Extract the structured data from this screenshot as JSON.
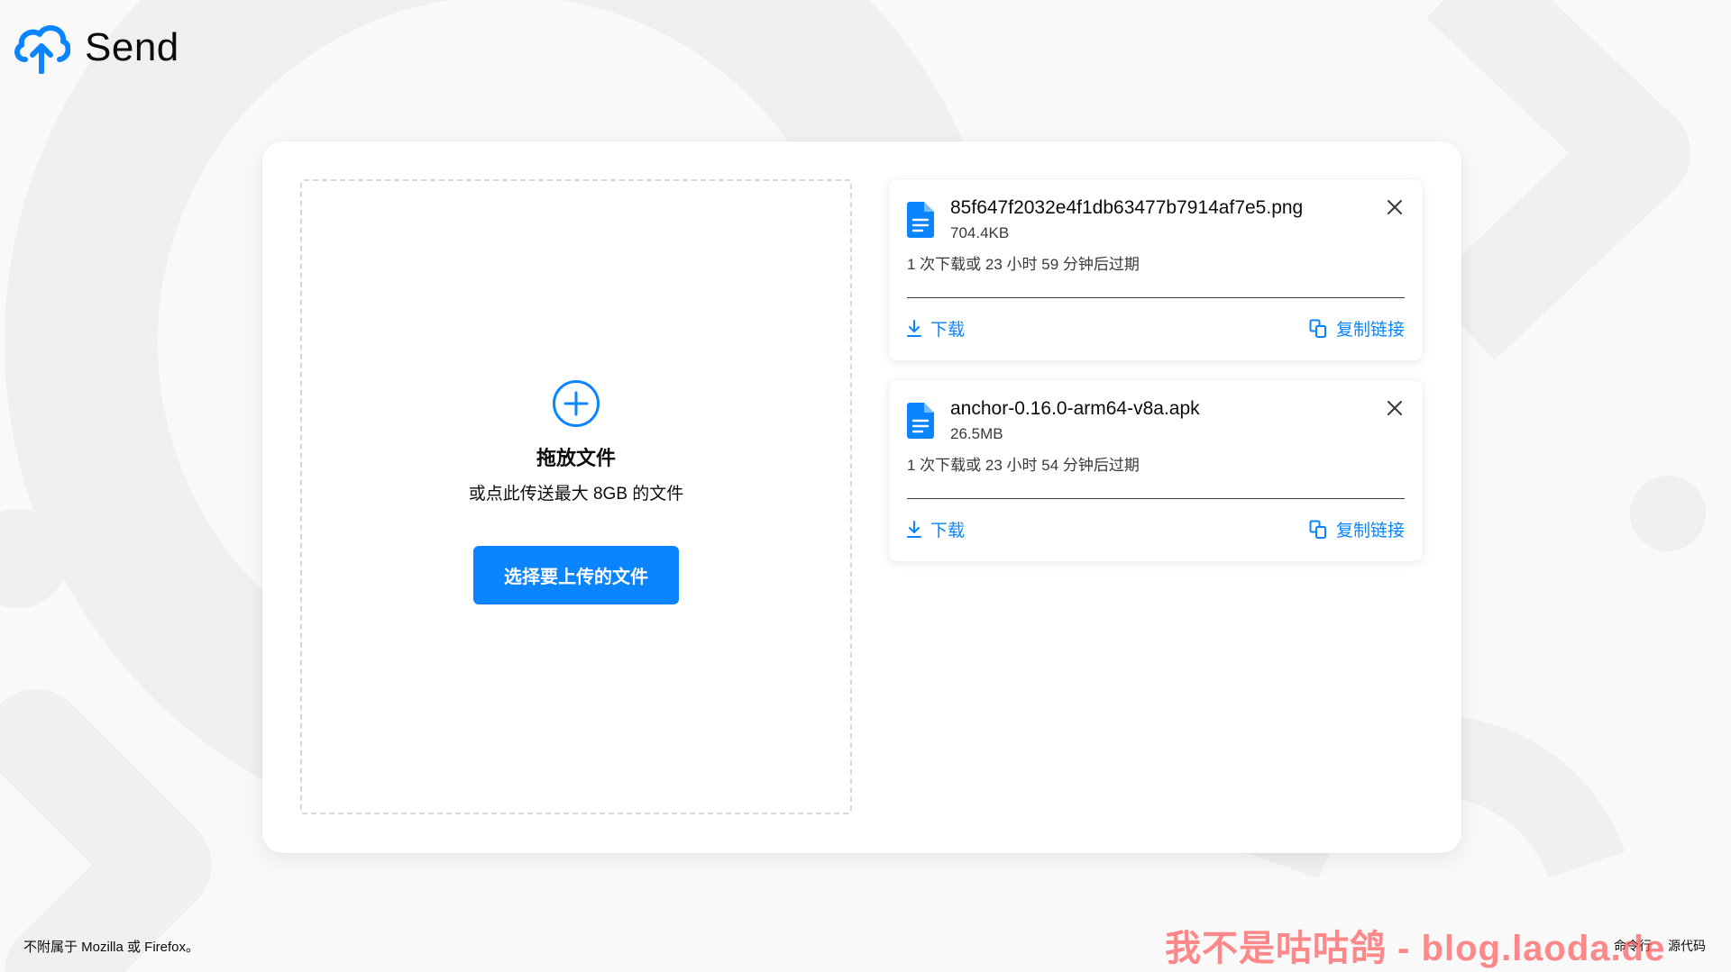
{
  "app": {
    "title": "Send",
    "logo_icon": "cloud-upload-icon"
  },
  "colors": {
    "accent": "#0a84ff",
    "background": "#f9f9fa",
    "watermark": "#ff4d4d"
  },
  "upload": {
    "plus_icon": "plus-circle-icon",
    "title": "拖放文件",
    "subtitle": "或点此传送最大 8GB 的文件",
    "button_label": "选择要上传的文件"
  },
  "files": [
    {
      "name": "85f647f2032e4f1db63477b7914af7e5.png",
      "size": "704.4KB",
      "expiry": "1 次下载或 23 小时 59 分钟后过期",
      "download_label": "下载",
      "copy_label": "复制链接"
    },
    {
      "name": "anchor-0.16.0-arm64-v8a.apk",
      "size": "26.5MB",
      "expiry": "1 次下载或 23 小时 54 分钟后过期",
      "download_label": "下载",
      "copy_label": "复制链接"
    }
  ],
  "footer": {
    "disclaimer": "不附属于 Mozilla 或 Firefox。",
    "links": [
      "命令行",
      "源代码"
    ]
  },
  "watermark": "我不是咕咕鸽 - blog.laoda.de"
}
